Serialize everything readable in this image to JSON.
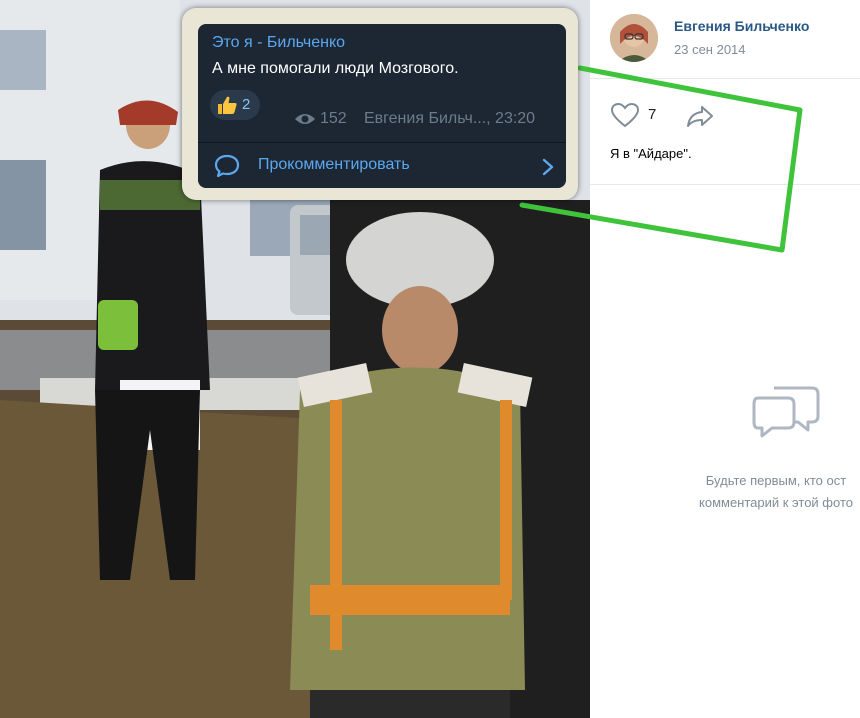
{
  "overlay": {
    "title": "Это я - Бильченко",
    "message": "А мне помогали люди Мозгового.",
    "reaction_count": "2",
    "views": "152",
    "author_time": "Евгения Бильч..., 23:20",
    "comment_label": "Прокомментировать"
  },
  "post": {
    "author_name": "Евгения Бильченко",
    "date": "23 сен 2014",
    "like_count": "7",
    "caption": "Я в \"Айдаре\"."
  },
  "comments_empty": {
    "line1": "Будьте первым, кто ост",
    "line2": "комментарий к этой фото"
  },
  "colors": {
    "vk_link": "#2a5885",
    "telegram_bg": "#1c2733",
    "telegram_accent": "#5ba8f0",
    "highlight_green": "#3fc33a"
  },
  "icons": [
    "eye-icon",
    "thumbs-up-icon",
    "comment-bubble-icon",
    "chevron-right-icon",
    "heart-icon",
    "share-icon",
    "comments-empty-icon"
  ]
}
